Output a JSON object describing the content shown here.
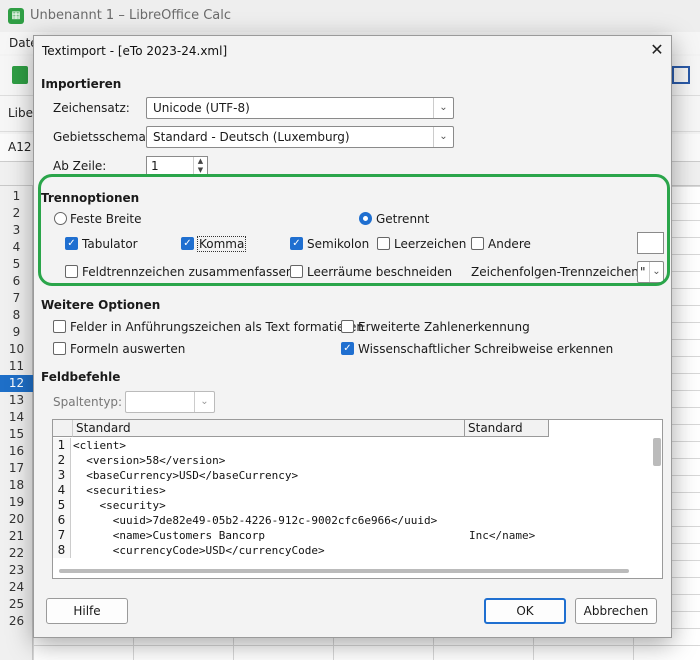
{
  "app": {
    "title": "Unbenannt 1 – LibreOffice Calc",
    "menu_first": "Date",
    "font_box": "Liber",
    "cell_ref": "A12"
  },
  "rows": [
    "1",
    "2",
    "3",
    "4",
    "5",
    "6",
    "7",
    "8",
    "9",
    "10",
    "11",
    "12",
    "13",
    "14",
    "15",
    "16",
    "17",
    "18",
    "19",
    "20",
    "21",
    "22",
    "23",
    "24",
    "25",
    "26"
  ],
  "selected_row": "12",
  "dialog": {
    "title": "Textimport - [eTo 2023-24.xml]",
    "import": {
      "heading": "Importieren",
      "charset_label": "Zeichensatz:",
      "charset_value": "Unicode (UTF-8)",
      "locale_label": "Gebietsschema:",
      "locale_value": "Standard - Deutsch (Luxemburg)",
      "from_row_label": "Ab Zeile:",
      "from_row_value": "1"
    },
    "separator": {
      "heading": "Trennoptionen",
      "fixed": "Feste Breite",
      "separated": "Getrennt",
      "tab": "Tabulator",
      "comma": "Komma",
      "semicolon": "Semikolon",
      "space": "Leerzeichen",
      "other": "Andere",
      "merge": "Feldtrennzeichen zusammenfassen",
      "trim": "Leerräume beschneiden",
      "string_delim_label": "Zeichenfolgen-Trennzeichen:",
      "string_delim_value": "\""
    },
    "other_options": {
      "heading": "Weitere Optionen",
      "quoted_text": "Felder in Anführungszeichen als Text formatieren",
      "detect_special": "Erweiterte Zahlenerkennung",
      "eval_formulas": "Formeln auswerten",
      "scientific": "Wissenschaftlicher Schreibweise erkennen"
    },
    "fields": {
      "heading": "Feldbefehle",
      "coltype_label": "Spaltentyp:",
      "col_headers": [
        "Standard",
        "Standard"
      ],
      "row_numbers": [
        "1",
        "2",
        "3",
        "4",
        "5",
        "6",
        "7",
        "8"
      ],
      "lines": [
        "<client>",
        "  <version>58</version>",
        "  <baseCurrency>USD</baseCurrency>",
        "  <securities>",
        "    <security>",
        "      <uuid>7de82e49-05b2-4226-912c-9002cfc6e966</uuid>",
        "      <name>Customers Bancorp",
        "      <currencyCode>USD</currencyCode>"
      ],
      "col2_cell": "Inc</name>"
    },
    "buttons": {
      "help": "Hilfe",
      "ok": "OK",
      "cancel": "Abbrechen"
    }
  }
}
